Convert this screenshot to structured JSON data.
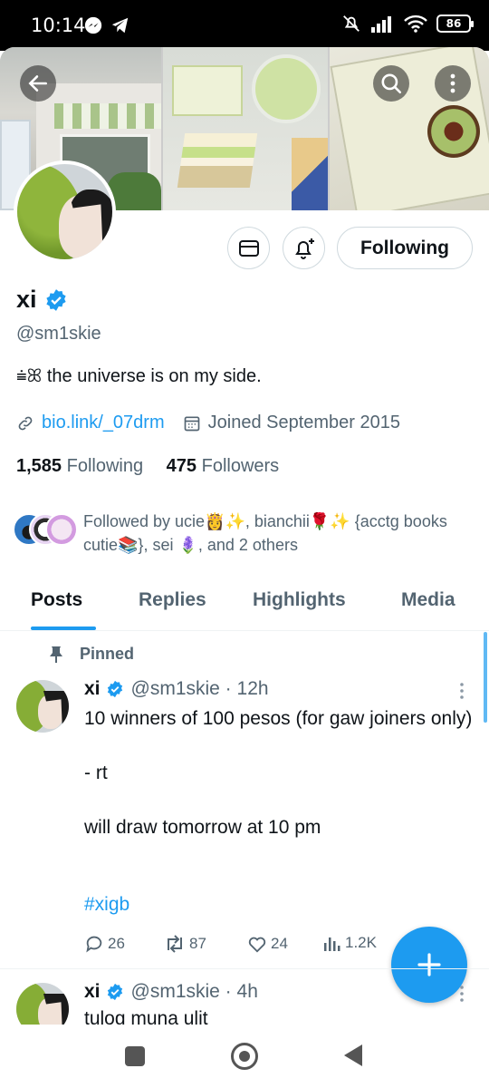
{
  "status_bar": {
    "time": "10:14",
    "battery": "86"
  },
  "profile": {
    "name": "xi",
    "handle": "@sm1skie",
    "bio": "⩧ꕤ the universe is on my side.",
    "link": "bio.link/_07drm",
    "joined": "Joined September 2015",
    "following_count": "1,585",
    "following_label": "Following",
    "followers_count": "475",
    "followers_label": "Followers",
    "follow_button_label": "Following",
    "followed_by": "Followed by ucie👸✨, bianchii🌹✨ {acctg books cutie📚}, sei 🪻, and 2 others"
  },
  "tabs": [
    {
      "label": "Posts",
      "active": true
    },
    {
      "label": "Replies",
      "active": false
    },
    {
      "label": "Highlights",
      "active": false
    },
    {
      "label": "Media",
      "active": false
    }
  ],
  "pinned_post": {
    "pinned_label": "Pinned",
    "name": "xi",
    "handle_time": "@sm1skie · 12h",
    "body": "10 winners of 100 pesos (for gaw joiners only)\n\n- rt\n\nwill draw tomorrow at 10 pm",
    "hashtag": "#xigb",
    "replies": "26",
    "reposts": "87",
    "likes": "24",
    "views": "1.2K"
  },
  "second_post": {
    "name": "xi",
    "handle_time": "@sm1skie · 4h",
    "body": "tulog muna ulit"
  },
  "colors": {
    "accent": "#1d9bf0",
    "text": "#0f1419",
    "secondary_text": "#536471",
    "border": "#cfd9de"
  },
  "icons": {
    "back": "arrow-left-icon",
    "search": "search-icon",
    "more": "more-vertical-icon",
    "message": "envelope-icon",
    "notify": "bell-plus-icon",
    "verified": "verified-badge-icon",
    "link": "link-icon",
    "calendar": "calendar-icon",
    "pin": "pin-icon",
    "reply": "reply-icon",
    "repost": "repost-icon",
    "like": "heart-icon",
    "views": "views-icon",
    "compose": "plus-icon"
  }
}
